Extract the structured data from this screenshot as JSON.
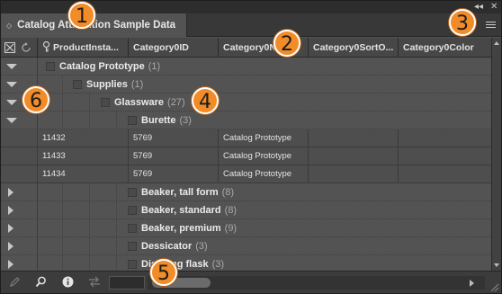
{
  "panel": {
    "tab_title": "Catalog Attribution Sample Data",
    "collapse_glyph": "◂◂",
    "close_glyph": "✕"
  },
  "columns": [
    {
      "label": "ProductInsta..."
    },
    {
      "label": "Category0ID"
    },
    {
      "label": "Category0Name"
    },
    {
      "label": "Category0SortO..."
    },
    {
      "label": "Category0Color"
    }
  ],
  "rows": [
    {
      "kind": "group",
      "level": 0,
      "expanded": true,
      "label": "Catalog Prototype",
      "count": "(1)"
    },
    {
      "kind": "group",
      "level": 1,
      "expanded": true,
      "label": "Supplies",
      "count": "(1)"
    },
    {
      "kind": "group",
      "level": 2,
      "expanded": true,
      "label": "Glassware",
      "count": "(27)"
    },
    {
      "kind": "group",
      "level": 3,
      "expanded": true,
      "label": "Burette",
      "count": "(3)"
    },
    {
      "kind": "data",
      "cells": [
        "11432",
        "5769",
        "Catalog Prototype",
        "",
        ""
      ]
    },
    {
      "kind": "data",
      "cells": [
        "11433",
        "5769",
        "Catalog Prototype",
        "",
        ""
      ]
    },
    {
      "kind": "data",
      "cells": [
        "11434",
        "5769",
        "Catalog Prototype",
        "",
        ""
      ]
    },
    {
      "kind": "group",
      "level": 3,
      "expanded": false,
      "label": "Beaker, tall form",
      "count": "(8)"
    },
    {
      "kind": "group",
      "level": 3,
      "expanded": false,
      "label": "Beaker, standard",
      "count": "(8)"
    },
    {
      "kind": "group",
      "level": 3,
      "expanded": false,
      "label": "Beaker, premium",
      "count": "(9)"
    },
    {
      "kind": "group",
      "level": 3,
      "expanded": false,
      "label": "Dessicator",
      "count": "(3)"
    },
    {
      "kind": "group",
      "level": 3,
      "expanded": false,
      "label": "Distilling flask",
      "count": "(3)"
    }
  ],
  "footer": {
    "search_value": "",
    "icons": [
      "pencil-icon",
      "search-icon",
      "info-icon",
      "swap-icon"
    ]
  },
  "callouts": [
    "1",
    "2",
    "3",
    "4",
    "5",
    "6"
  ],
  "colors": {
    "accent_callout": "#f28c28",
    "panel_bg": "#535353"
  }
}
